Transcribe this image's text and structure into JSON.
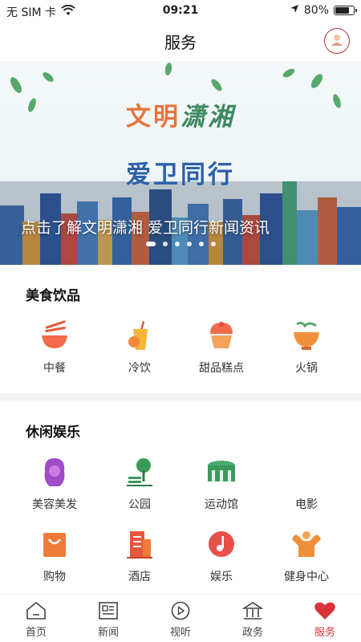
{
  "status_bar": {
    "carrier": "无 SIM 卡",
    "time": "09:21",
    "battery_percent": "80%",
    "battery_level": 0.8
  },
  "nav": {
    "title": "服务"
  },
  "banner": {
    "line1_a": "文明",
    "line1_b": "潇湘",
    "line2": "爱卫同行",
    "caption": "点击了解文明潇湘 爱卫同行新闻资讯",
    "slide_count": 6,
    "active_slide": 1
  },
  "food": {
    "title": "美食饮品",
    "items": [
      {
        "label": "中餐",
        "icon": "bowl-icon"
      },
      {
        "label": "冷饮",
        "icon": "cold-drink-icon"
      },
      {
        "label": "甜品糕点",
        "icon": "cupcake-icon"
      },
      {
        "label": "火锅",
        "icon": "hotpot-icon"
      }
    ]
  },
  "leisure": {
    "title": "休闲娱乐",
    "items": [
      {
        "label": "美容美发",
        "icon": "hair-beauty-icon"
      },
      {
        "label": "公园",
        "icon": "park-icon"
      },
      {
        "label": "运动馆",
        "icon": "stadium-icon"
      },
      {
        "label": "电影",
        "icon": "movie-icon"
      },
      {
        "label": "购物",
        "icon": "shopping-bag-icon"
      },
      {
        "label": "酒店",
        "icon": "hotel-icon"
      },
      {
        "label": "娱乐",
        "icon": "music-icon"
      },
      {
        "label": "健身中心",
        "icon": "fitness-icon"
      }
    ]
  },
  "tabs": [
    {
      "label": "首页",
      "icon": "home-icon"
    },
    {
      "label": "新闻",
      "icon": "news-icon"
    },
    {
      "label": "视听",
      "icon": "play-icon"
    },
    {
      "label": "政务",
      "icon": "government-icon"
    },
    {
      "label": "服务",
      "icon": "heart-icon",
      "active": true
    }
  ],
  "colors": {
    "accent": "#d7353b",
    "icon_orange": "#f07a3a",
    "icon_green": "#3a9a5b",
    "icon_purple": "#8a3fb3"
  }
}
